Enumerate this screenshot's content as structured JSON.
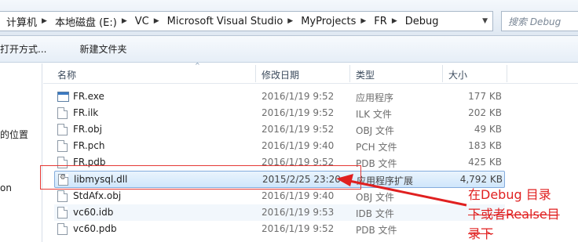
{
  "address": {
    "crumbs": [
      "计算机",
      "本地磁盘 (E:)",
      "VC",
      "Microsoft Visual Studio",
      "MyProjects",
      "FR",
      "Debug"
    ],
    "search_placeholder": "搜索 Debug"
  },
  "toolbar": {
    "open_with": "打开方式...",
    "new_folder": "新建文件夹"
  },
  "nav": {
    "item1": "的位置",
    "item2": "on"
  },
  "columns": {
    "name": "名称",
    "date": "修改日期",
    "type": "类型",
    "size": "大小"
  },
  "files": [
    {
      "name": "FR.exe",
      "date": "2016/1/19 9:52",
      "type": "应用程序",
      "size": "177 KB",
      "icon": "exe-icon"
    },
    {
      "name": "FR.ilk",
      "date": "2016/1/19 9:52",
      "type": "ILK 文件",
      "size": "202 KB",
      "icon": "file-icon"
    },
    {
      "name": "FR.obj",
      "date": "2016/1/19 9:52",
      "type": "OBJ 文件",
      "size": "49 KB",
      "icon": "file-icon"
    },
    {
      "name": "FR.pch",
      "date": "2016/1/19 9:40",
      "type": "PCH 文件",
      "size": "183 KB",
      "icon": "file-icon"
    },
    {
      "name": "FR.pdb",
      "date": "2016/1/19 9:52",
      "type": "PDB 文件",
      "size": "425 KB",
      "icon": "file-icon"
    },
    {
      "name": "libmysql.dll",
      "date": "2015/2/25 23:20",
      "type": "应用程序扩展",
      "size": "4,792 KB",
      "icon": "dll-icon"
    },
    {
      "name": "StdAfx.obj",
      "date": "2016/1/19 9:40",
      "type": "OBJ 文件",
      "size": "",
      "icon": "file-icon"
    },
    {
      "name": "vc60.idb",
      "date": "2016/1/19 9:53",
      "type": "IDB 文件",
      "size": "",
      "icon": "file-icon"
    },
    {
      "name": "vc60.pdb",
      "date": "2016/1/19 9:52",
      "type": "PDB 文件",
      "size": "",
      "icon": "file-icon"
    }
  ],
  "annotation": {
    "line1": "在Debug 目录",
    "line2": "下或者Realse目",
    "line3": "录下",
    "color": "#e02020"
  },
  "colors": {
    "selection": "#cfe6fb",
    "selection_border": "#84acdd"
  }
}
